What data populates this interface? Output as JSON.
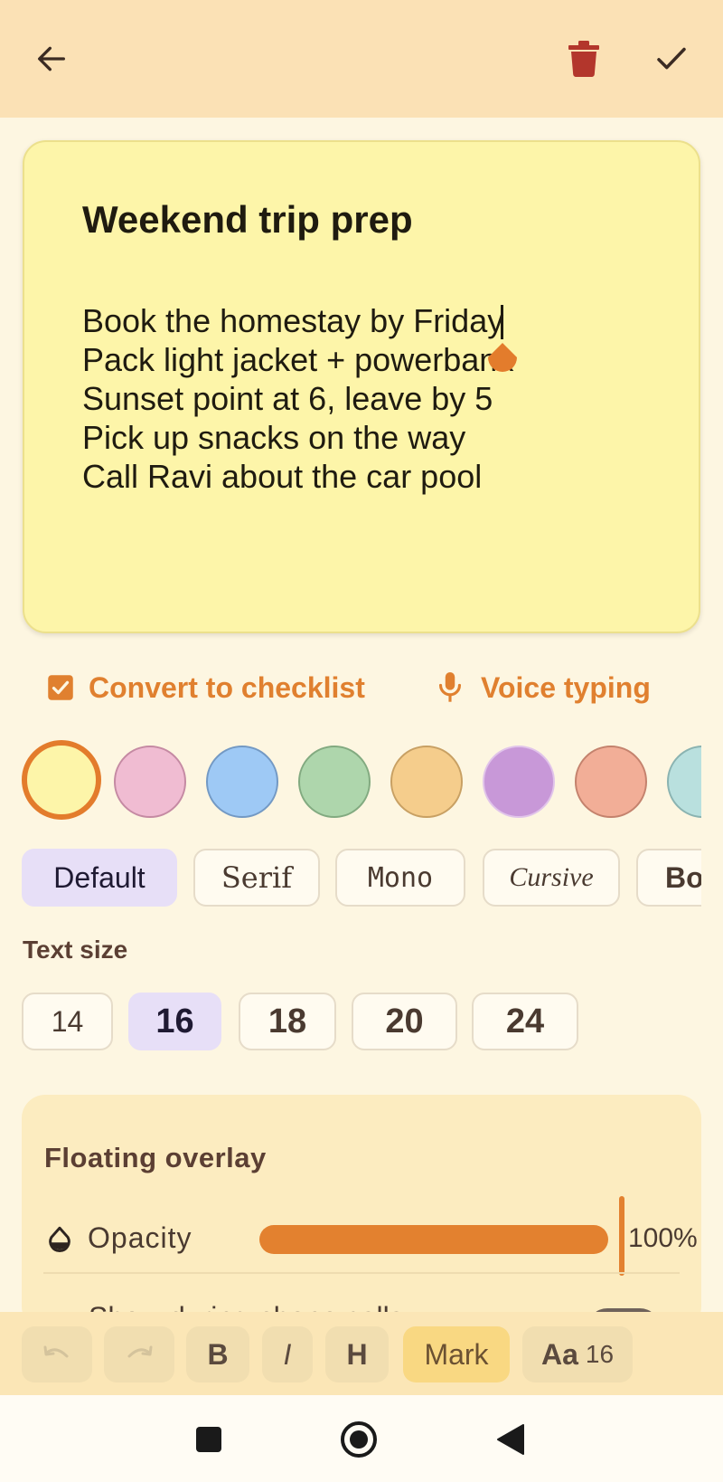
{
  "topbar": {
    "back_icon": "arrow-left-icon",
    "delete_icon": "trash-icon",
    "confirm_icon": "checkmark-icon"
  },
  "note": {
    "title": "Weekend trip prep",
    "body": "Book the homestay by Friday\nPack light jacket + powerbank\nSunset point at 6, leave by 5\nPick up snacks on the way\nCall Ravi about the car pool",
    "background": "#fdf5a9"
  },
  "actions": {
    "checklist_label": "Convert to checklist",
    "voice_label": "Voice typing",
    "accent": "#e0802f"
  },
  "colors": {
    "selected_index": 0,
    "swatches": [
      {
        "fill": "#fdf5a9",
        "border": "#e37c2c"
      },
      {
        "fill": "#f0bcd2",
        "border": "#c58aa3"
      },
      {
        "fill": "#9ec9f5",
        "border": "#7399c4"
      },
      {
        "fill": "#aed6ac",
        "border": "#82aa80"
      },
      {
        "fill": "#f5cd8c",
        "border": "#c8a063"
      },
      {
        "fill": "#c898d8",
        "border": "#e1c4ea"
      },
      {
        "fill": "#f2ae97",
        "border": "#c4826d"
      },
      {
        "fill": "#b9e0de",
        "border": "#8ab3b1"
      }
    ]
  },
  "fonts": {
    "selected": "Default",
    "items": [
      "Default",
      "Serif",
      "Mono",
      "Cursive",
      "Bold"
    ]
  },
  "text_size": {
    "label": "Text size",
    "selected": "16",
    "options": [
      "14",
      "16",
      "18",
      "20",
      "24"
    ]
  },
  "overlay": {
    "title": "Floating overlay",
    "opacity_label": "Opacity",
    "opacity_value": "100%",
    "opacity_fraction": 1.0,
    "phone_calls_label": "Show during phone calls"
  },
  "toolbar": {
    "bold": "B",
    "italic": "I",
    "heading": "H",
    "mark": "Mark",
    "size_prefix": "Aa",
    "size_value": "16"
  }
}
